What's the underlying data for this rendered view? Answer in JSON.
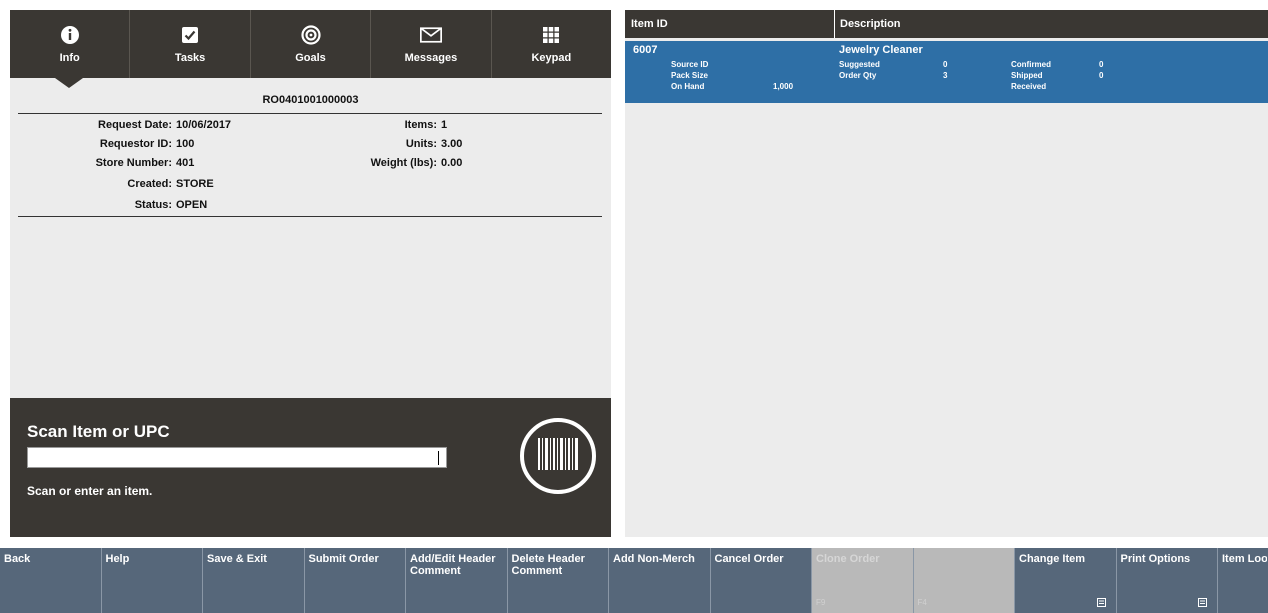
{
  "nav": {
    "tabs": [
      {
        "label": "Info",
        "icon": "info-icon"
      },
      {
        "label": "Tasks",
        "icon": "checkbox-icon"
      },
      {
        "label": "Goals",
        "icon": "target-icon"
      },
      {
        "label": "Messages",
        "icon": "envelope-icon"
      },
      {
        "label": "Keypad",
        "icon": "keypad-icon"
      }
    ]
  },
  "order": {
    "number": "RO0401001000003",
    "request_date_label": "Request Date:",
    "request_date": "10/06/2017",
    "requestor_label": "Requestor ID:",
    "requestor": "100",
    "store_label": "Store Number:",
    "store": "401",
    "created_label": "Created:",
    "created": "STORE",
    "status_label": "Status:",
    "status": "OPEN",
    "items_label": "Items:",
    "items": "1",
    "units_label": "Units:",
    "units": "3.00",
    "weight_label": "Weight (lbs):",
    "weight": "0.00"
  },
  "scan": {
    "title": "Scan Item or UPC",
    "value": "",
    "help": "Scan or enter an item."
  },
  "grid": {
    "headers": {
      "item_id": "Item ID",
      "description": "Description"
    },
    "row": {
      "item_id": "6007",
      "description": "Jewelry Cleaner",
      "source_id_label": "Source ID",
      "source_id": "",
      "pack_size_label": "Pack Size",
      "pack_size": "",
      "on_hand_label": "On Hand",
      "on_hand": "1,000",
      "suggested_label": "Suggested",
      "suggested": "0",
      "order_qty_label": "Order Qty",
      "order_qty": "3",
      "confirmed_label": "Confirmed",
      "confirmed": "0",
      "shipped_label": "Shipped",
      "shipped": "0",
      "received_label": "Received",
      "received": ""
    }
  },
  "toolbar": {
    "buttons": [
      {
        "label": "Back",
        "fkey": ""
      },
      {
        "label": "Help",
        "fkey": ""
      },
      {
        "label": "Save & Exit",
        "fkey": ""
      },
      {
        "label": "Submit Order",
        "fkey": ""
      },
      {
        "label": "Add/Edit Header Comment",
        "fkey": ""
      },
      {
        "label": "Delete Header Comment",
        "fkey": ""
      },
      {
        "label": "Add Non-Merch",
        "fkey": ""
      },
      {
        "label": "Cancel Order",
        "fkey": ""
      },
      {
        "label": "Clone Order",
        "fkey": "F9"
      },
      {
        "label": "",
        "fkey": "F4"
      },
      {
        "label": "Change Item",
        "fkey": ""
      },
      {
        "label": "Print Options",
        "fkey": ""
      },
      {
        "label": "Item Lookup",
        "fkey": ""
      }
    ]
  },
  "colors": {
    "dark_panel": "#3a3733",
    "selected_row": "#2e6fa6",
    "toolbar": "#56677a",
    "panel_bg": "#ececec"
  }
}
